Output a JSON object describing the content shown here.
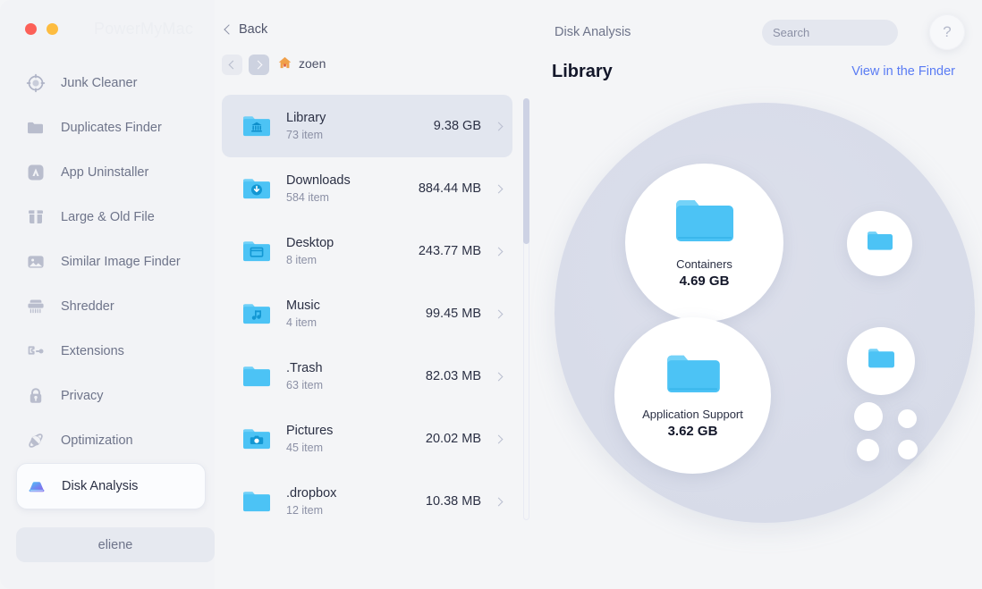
{
  "window": {
    "brand": "PowerMyMac",
    "traffic_lights": [
      "close-red",
      "minimize-amber"
    ],
    "back_label": "Back"
  },
  "header": {
    "module_title": "Disk Analysis",
    "help_label": "?"
  },
  "search": {
    "placeholder": "Search",
    "value": ""
  },
  "sidebar": {
    "items": [
      {
        "label": "Junk Cleaner",
        "icon": "target-icon",
        "active": false
      },
      {
        "label": "Duplicates Finder",
        "icon": "folder-icon",
        "active": false
      },
      {
        "label": "App Uninstaller",
        "icon": "app-store-icon",
        "active": false
      },
      {
        "label": "Large & Old File",
        "icon": "box-icon",
        "active": false
      },
      {
        "label": "Similar Image Finder",
        "icon": "image-icon",
        "active": false
      },
      {
        "label": "Shredder",
        "icon": "shredder-icon",
        "active": false
      },
      {
        "label": "Extensions",
        "icon": "puzzle-icon",
        "active": false
      },
      {
        "label": "Privacy",
        "icon": "lock-icon",
        "active": false
      },
      {
        "label": "Optimization",
        "icon": "atom-icon",
        "active": false
      },
      {
        "label": "Disk Analysis",
        "icon": "hard-drive-icon",
        "active": true
      }
    ],
    "account_label": "eliene"
  },
  "breadcrumb": {
    "home_icon": "home-icon",
    "path": "zoen",
    "back_enabled": false,
    "forward_enabled": true
  },
  "filelist": {
    "rows": [
      {
        "name": "Library",
        "count": "73 item",
        "size": "9.38 GB",
        "icon": "folder-library-icon",
        "selected": true
      },
      {
        "name": "Downloads",
        "count": "584 item",
        "size": "884.44 MB",
        "icon": "folder-downloads-icon",
        "selected": false
      },
      {
        "name": "Desktop",
        "count": "8 item",
        "size": "243.77 MB",
        "icon": "folder-desktop-icon",
        "selected": false
      },
      {
        "name": "Music",
        "count": "4 item",
        "size": "99.45 MB",
        "icon": "folder-music-icon",
        "selected": false
      },
      {
        "name": ".Trash",
        "count": "63 item",
        "size": "82.03 MB",
        "icon": "folder-plain-icon",
        "selected": false
      },
      {
        "name": "Pictures",
        "count": "45 item",
        "size": "20.02 MB",
        "icon": "folder-pictures-icon",
        "selected": false
      },
      {
        "name": ".dropbox",
        "count": "12 item",
        "size": "10.38 MB",
        "icon": "folder-plain-icon",
        "selected": false
      }
    ]
  },
  "panel": {
    "title": "Library",
    "finder_link": "View in the Finder"
  },
  "chart_data": {
    "type": "bubble",
    "title": "Library",
    "unit": "GB",
    "bubbles": [
      {
        "label": "Containers",
        "size_text": "4.69 GB",
        "value": 4.69,
        "labeled": true
      },
      {
        "label": "Application Support",
        "size_text": "3.62 GB",
        "value": 3.62,
        "labeled": true
      },
      {
        "label": "",
        "size_text": "",
        "value": 0.8,
        "labeled": false
      },
      {
        "label": "",
        "size_text": "",
        "value": 0.85,
        "labeled": false
      },
      {
        "label": "",
        "size_text": "",
        "value": 0.18,
        "labeled": false
      },
      {
        "label": "",
        "size_text": "",
        "value": 0.08,
        "labeled": false
      },
      {
        "label": "",
        "size_text": "",
        "value": 0.11,
        "labeled": false
      },
      {
        "label": "",
        "size_text": "",
        "value": 0.09,
        "labeled": false
      }
    ],
    "total_text": "9.38 GB",
    "legend": "none",
    "grid": false
  },
  "colors": {
    "accent_link": "#5a7cf4",
    "folder_blue": "#4cc3f5",
    "background": "#f4f5f7",
    "selected_row": "#e2e6ef",
    "bubble_field": "#d8dce9"
  }
}
